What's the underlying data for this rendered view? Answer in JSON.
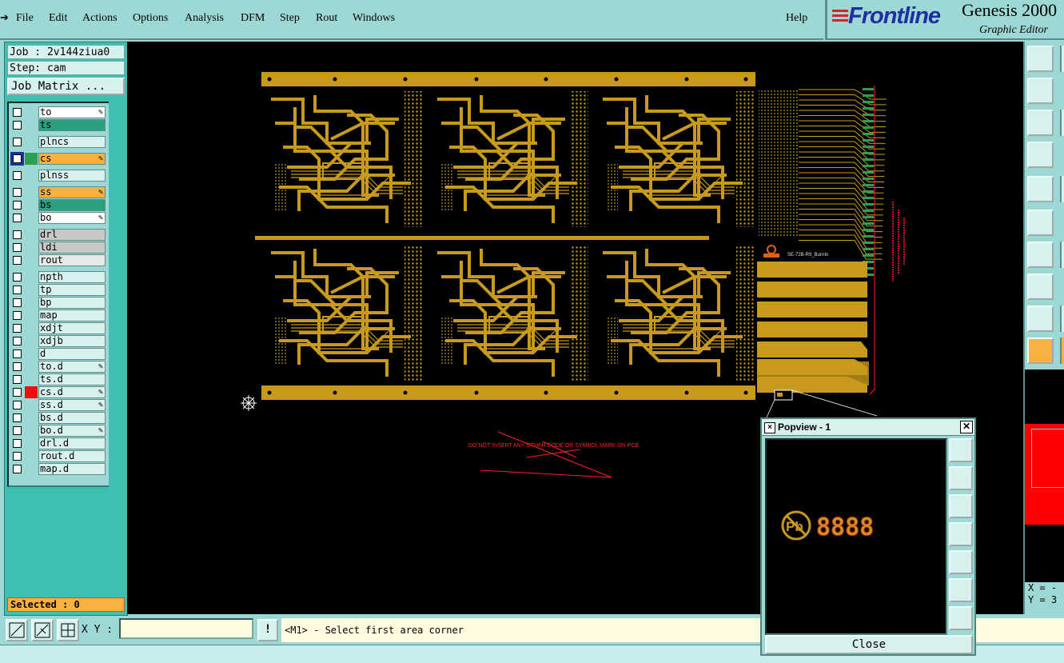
{
  "menu": {
    "items": [
      "File",
      "Edit",
      "Actions",
      "Options",
      "Analysis",
      "DFM",
      "Step",
      "Rout",
      "Windows"
    ],
    "help": "Help"
  },
  "brand": {
    "logo": "Frontline",
    "product": "Genesis 2000",
    "subtitle": "Graphic Editor"
  },
  "job": {
    "job_line": "Job : 2v144ziua0",
    "step_line": "Step: cam",
    "matrix_button": "Job Matrix ..."
  },
  "layers": [
    {
      "name": "to",
      "color": "#ffffff",
      "pen": true
    },
    {
      "name": "ts",
      "color": "#2ba080"
    },
    {
      "name": "plncs",
      "color": "#d8f0ee"
    },
    {
      "name": "cs",
      "color": "#f8b040",
      "pen": true,
      "active": true,
      "swatch": "#1e2f9f",
      "swatch2": "#2ba050"
    },
    {
      "name": "plnss",
      "color": "#d8f0ee"
    },
    {
      "name": "ss",
      "color": "#f8b040",
      "pen": true
    },
    {
      "name": "bs",
      "color": "#2ba080"
    },
    {
      "name": "bo",
      "color": "#ffffff",
      "pen": true
    },
    {
      "name": "drl",
      "color": "#c8c8c8"
    },
    {
      "name": "ldi",
      "color": "#c8c8c8"
    },
    {
      "name": "rout",
      "color": "#e8e8e8"
    },
    {
      "name": "npth",
      "color": "#d8f0ee"
    },
    {
      "name": "tp",
      "color": "#d8f0ee"
    },
    {
      "name": "bp",
      "color": "#d8f0ee"
    },
    {
      "name": "map",
      "color": "#d8f0ee"
    },
    {
      "name": "xdjt",
      "color": "#d8f0ee"
    },
    {
      "name": "xdjb",
      "color": "#d8f0ee"
    },
    {
      "name": "d",
      "color": "#d8f0ee"
    },
    {
      "name": "to.d",
      "color": "#d8f0ee",
      "pen": true
    },
    {
      "name": "ts.d",
      "color": "#d8f0ee"
    },
    {
      "name": "cs.d",
      "color": "#d8f0ee",
      "pen": true,
      "swatch2": "#ee1010"
    },
    {
      "name": "ss.d",
      "color": "#d8f0ee",
      "pen": true
    },
    {
      "name": "bs.d",
      "color": "#d8f0ee"
    },
    {
      "name": "bo.d",
      "color": "#d8f0ee",
      "pen": true
    },
    {
      "name": "drl.d",
      "color": "#d8f0ee"
    },
    {
      "name": "rout.d",
      "color": "#d8f0ee"
    },
    {
      "name": "map.d",
      "color": "#d8f0ee"
    }
  ],
  "selected": "Selected : 0",
  "board": {
    "label": "SE-72B-R9_BurnIn",
    "warning": "DO NOT INSERT ANY OTHER CODE OR SYMBOL MARK ON PCB.",
    "trace_color": "#c89a1c",
    "warning_color": "#ff2020"
  },
  "coords": {
    "x_label": "X = -",
    "y_label": "Y = 3"
  },
  "bottom": {
    "xy_label": "X Y :",
    "xy_value": "",
    "bang": "!",
    "prompt": "<M1> - Select first area corner"
  },
  "popview": {
    "title": "Popview - 1",
    "close_label": "Close",
    "digits": "8888",
    "symbol": "Pb"
  }
}
